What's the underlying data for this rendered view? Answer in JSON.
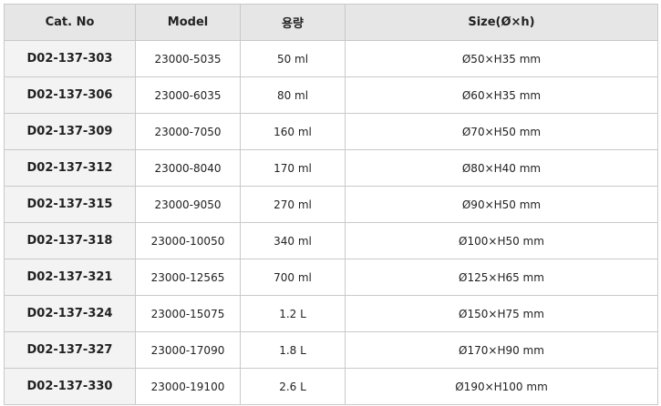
{
  "table": {
    "headers": {
      "cat_no": "Cat. No",
      "model": "Model",
      "capacity": "용량",
      "size": "Size(Ø×h)"
    },
    "rows": [
      {
        "cat_no": "D02-137-303",
        "model": "23000-5035",
        "capacity": "50 ml",
        "size": "Ø50×H35  mm"
      },
      {
        "cat_no": "D02-137-306",
        "model": "23000-6035",
        "capacity": "80 ml",
        "size": "Ø60×H35  mm"
      },
      {
        "cat_no": "D02-137-309",
        "model": "23000-7050",
        "capacity": "160 ml",
        "size": "Ø70×H50  mm"
      },
      {
        "cat_no": "D02-137-312",
        "model": "23000-8040",
        "capacity": "170 ml",
        "size": "Ø80×H40  mm"
      },
      {
        "cat_no": "D02-137-315",
        "model": "23000-9050",
        "capacity": "270 ml",
        "size": "Ø90×H50  mm"
      },
      {
        "cat_no": "D02-137-318",
        "model": "23000-10050",
        "capacity": "340 ml",
        "size": "Ø100×H50  mm"
      },
      {
        "cat_no": "D02-137-321",
        "model": "23000-12565",
        "capacity": "700 ml",
        "size": "Ø125×H65  mm"
      },
      {
        "cat_no": "D02-137-324",
        "model": "23000-15075",
        "capacity": "1.2 L",
        "size": "Ø150×H75  mm"
      },
      {
        "cat_no": "D02-137-327",
        "model": "23000-17090",
        "capacity": "1.8 L",
        "size": "Ø170×H90  mm"
      },
      {
        "cat_no": "D02-137-330",
        "model": "23000-19100",
        "capacity": "2.6 L",
        "size": "Ø190×H100  mm"
      }
    ]
  }
}
